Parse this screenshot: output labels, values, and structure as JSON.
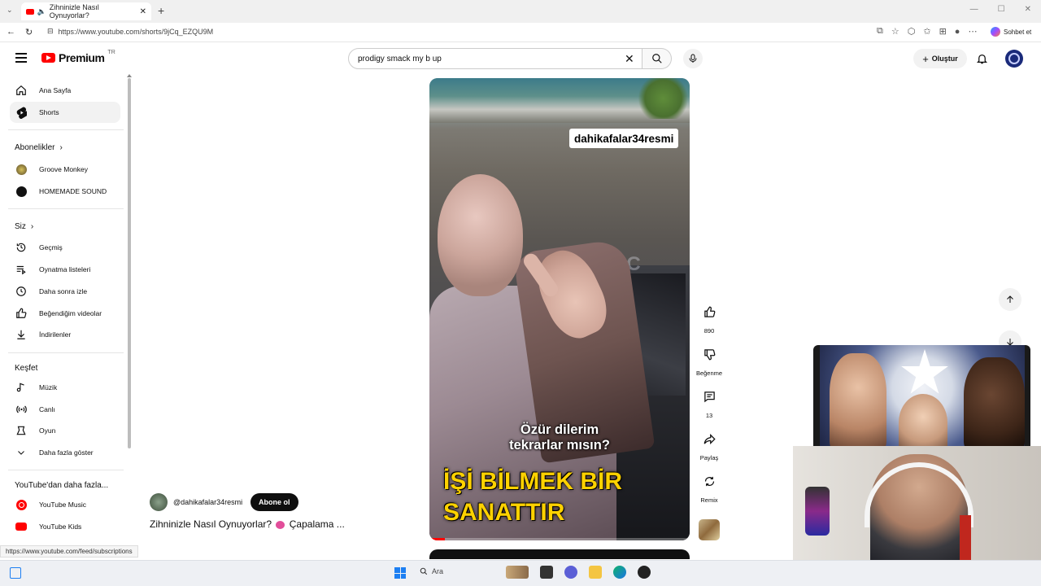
{
  "browser": {
    "tab_title": "Zihninizle Nasıl Oynuyorlar?",
    "url": "https://www.youtube.com/shorts/9jCq_EZQU9M",
    "copilot_label": "Sohbet et"
  },
  "header": {
    "logo_text": "Premium",
    "logo_region": "TR",
    "search_value": "prodigy smack my b up",
    "create_label": "Oluştur"
  },
  "sidebar": {
    "top": [
      {
        "label": "Ana Sayfa",
        "icon": "home-icon"
      },
      {
        "label": "Shorts",
        "icon": "shorts-icon",
        "active": true
      }
    ],
    "subscriptions_heading": "Abonelikler",
    "subscriptions": [
      {
        "label": "Groove Monkey"
      },
      {
        "label": "HOMEMADE SOUND"
      }
    ],
    "you_heading": "Siz",
    "you": [
      {
        "label": "Geçmiş",
        "icon": "history-icon"
      },
      {
        "label": "Oynatma listeleri",
        "icon": "playlist-icon"
      },
      {
        "label": "Daha sonra izle",
        "icon": "clock-icon"
      },
      {
        "label": "Beğendiğim videolar",
        "icon": "thumbs-up-icon"
      },
      {
        "label": "İndirilenler",
        "icon": "download-icon"
      }
    ],
    "explore_heading": "Keşfet",
    "explore": [
      {
        "label": "Müzik",
        "icon": "music-icon"
      },
      {
        "label": "Canlı",
        "icon": "live-icon"
      },
      {
        "label": "Oyun",
        "icon": "gaming-icon"
      },
      {
        "label": "Daha fazla göster",
        "icon": "chevron-down-icon"
      }
    ],
    "more_heading": "YouTube'dan daha fazla...",
    "more": [
      {
        "label": "YouTube Music",
        "icon": "youtube-music-icon"
      },
      {
        "label": "YouTube Kids",
        "icon": "youtube-kids-icon"
      }
    ]
  },
  "video": {
    "watermark": "dahikafalar34resmi",
    "subtitle_line1": "Özür dilerim",
    "subtitle_line2": "tekrarlar mısın?",
    "caption_line1": "İŞİ BİLMEK BİR",
    "caption_line2": "SANATTIR",
    "scene_text": "BUIC",
    "progress": 0.06
  },
  "actions": {
    "like_count": "890",
    "dislike_label": "Beğenme",
    "comment_count": "13",
    "share_label": "Paylaş",
    "remix_label": "Remix"
  },
  "channel": {
    "handle": "@dahikafalar34resmi",
    "subscribe_label": "Abone ol",
    "title_part1": "Zihninizle Nasıl Oynuyorlar?",
    "title_part2": "Çapalama ..."
  },
  "status_link": "https://www.youtube.com/feed/subscriptions",
  "taskbar": {
    "search_label": "Ara"
  },
  "colors": {
    "youtube_red": "#ff0000",
    "caption_yellow": "#ffd200",
    "subscribe_bg": "#0f0f0f"
  }
}
